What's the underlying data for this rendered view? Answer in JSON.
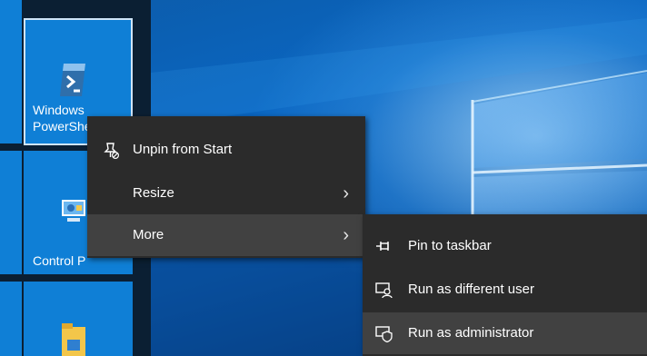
{
  "tiles": {
    "powershell": {
      "label_line1": "Windows",
      "label_line2": "PowerShe"
    },
    "control_panel": {
      "label": "Control P"
    }
  },
  "context_menu": {
    "items": [
      {
        "label": "Unpin from Start",
        "icon": "unpin-icon"
      },
      {
        "label": "Resize",
        "submenu_indicator": "›"
      },
      {
        "label": "More",
        "submenu_indicator": "›",
        "highlighted": true
      }
    ]
  },
  "submenu": {
    "items": [
      {
        "label": "Pin to taskbar",
        "icon": "pin-icon"
      },
      {
        "label": "Run as different user",
        "icon": "run-as-user-icon"
      },
      {
        "label": "Run as administrator",
        "icon": "shield-icon",
        "highlighted": true
      }
    ]
  },
  "colors": {
    "menu_bg": "#2b2b2b",
    "menu_hover": "#414141",
    "tile_blue": "#0f7fd6",
    "start_bg": "#0b1f33"
  }
}
